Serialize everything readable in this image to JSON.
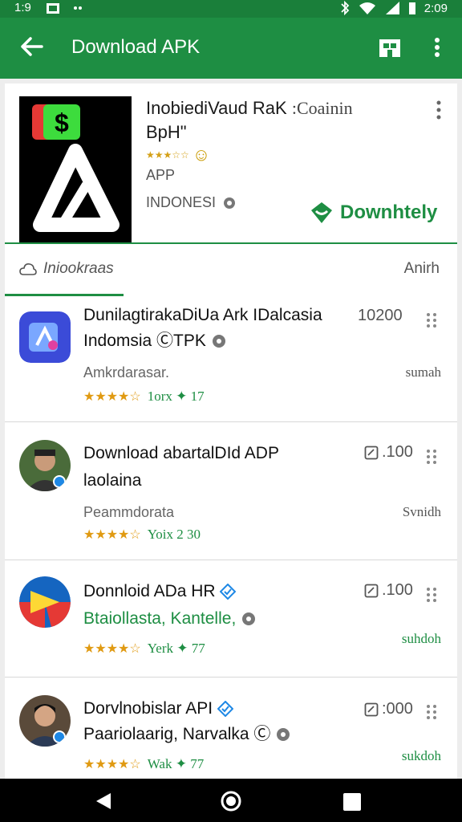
{
  "status_bar": {
    "time": "1:9",
    "clock": "2:09"
  },
  "app_bar": {
    "title": "Download APK"
  },
  "featured": {
    "title_line1": "InobiediVaud RaK",
    "title_suffix": ":Coainin",
    "title_line2": "BpH\"",
    "category": "APP",
    "country": "INDONESI",
    "download_label": "Downhtely"
  },
  "tabs": {
    "left": "Iniookraas",
    "right": "Anirh"
  },
  "list": [
    {
      "title_line1": "DunilagtirakaDiUa Ark IDalcasia",
      "title_line2": "Indomsia ⒸTPK",
      "developer": "Amkrdarasar.",
      "rating_meta": "1orx ✦ 17",
      "count": "10200",
      "action": "sumah"
    },
    {
      "title_line1": "Download abartalDId ADP",
      "title_line2": "laolaina",
      "developer": "Peammdorata",
      "rating_meta": "Yoix 2 30",
      "count": ".100",
      "action": "Svnidh"
    },
    {
      "title_line1": "Donnloid ADa HR",
      "title_line2": "Btaiollasta, Kantelle,",
      "developer": "",
      "rating_meta": "Yerk ✦ 77",
      "count": ".100",
      "action": "suhdoh"
    },
    {
      "title_line1": "Dorvlnobislar API",
      "title_line2": "Paariolaarig, Narvalka Ⓒ",
      "developer": "",
      "rating_meta": "Wak ✦ 77",
      "count": ":000",
      "action": "sukdoh"
    }
  ],
  "colors": {
    "primary": "#1e8e43",
    "status_bar": "#1a7f3a",
    "star": "#e09a12"
  }
}
